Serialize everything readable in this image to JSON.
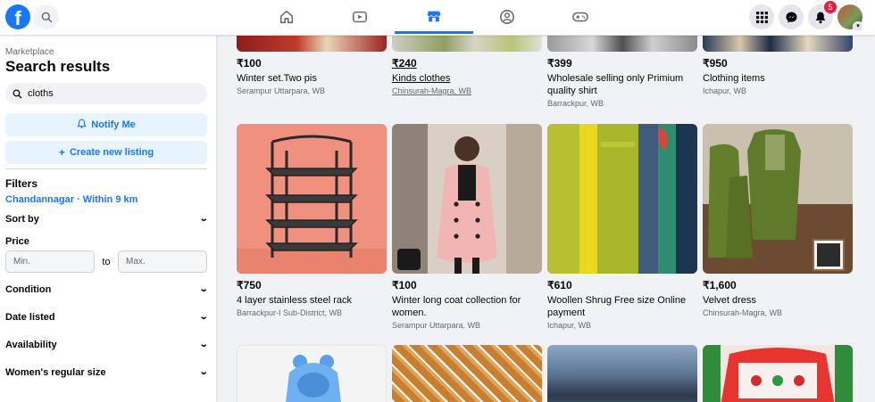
{
  "nav": {
    "badge_count": "5"
  },
  "sidebar": {
    "breadcrumb": "Marketplace",
    "title": "Search results",
    "search_value": "cloths",
    "notify_label": "Notify Me",
    "create_label": "Create new listing",
    "filters_title": "Filters",
    "location": "Chandannagar · Within 9 km",
    "sort_label": "Sort by",
    "price_label": "Price",
    "min_placeholder": "Min.",
    "price_to": "to",
    "max_placeholder": "Max.",
    "condition_label": "Condition",
    "date_label": "Date listed",
    "availability_label": "Availability",
    "size_label": "Women's regular size"
  },
  "listings": [
    {
      "price": "₹100",
      "title": "Winter set.Two pis",
      "location": "Serampur Uttarpara, WB"
    },
    {
      "price": "₹240",
      "title": "Kinds clothes",
      "location": "Chinsurah-Magra, WB"
    },
    {
      "price": "₹399",
      "title": "Wholesale selling only Primium quality shirt",
      "location": "Barrackpur, WB"
    },
    {
      "price": "₹950",
      "title": "Clothing items",
      "location": "Ichapur, WB"
    },
    {
      "price": "₹750",
      "title": "4 layer stainless steel rack",
      "location": "Barrackpur-I Sub-District, WB"
    },
    {
      "price": "₹100",
      "title": "Winter long coat collection for women.",
      "location": "Serampur Uttarpara, WB"
    },
    {
      "price": "₹610",
      "title": "Woollen Shrug Free size Online payment",
      "location": "Ichapur, WB"
    },
    {
      "price": "₹1,600",
      "title": "Velvet dress",
      "location": "Chinsurah-Magra, WB"
    }
  ],
  "colors": {
    "brand": "#1877f2",
    "badge": "#e41e3f"
  }
}
